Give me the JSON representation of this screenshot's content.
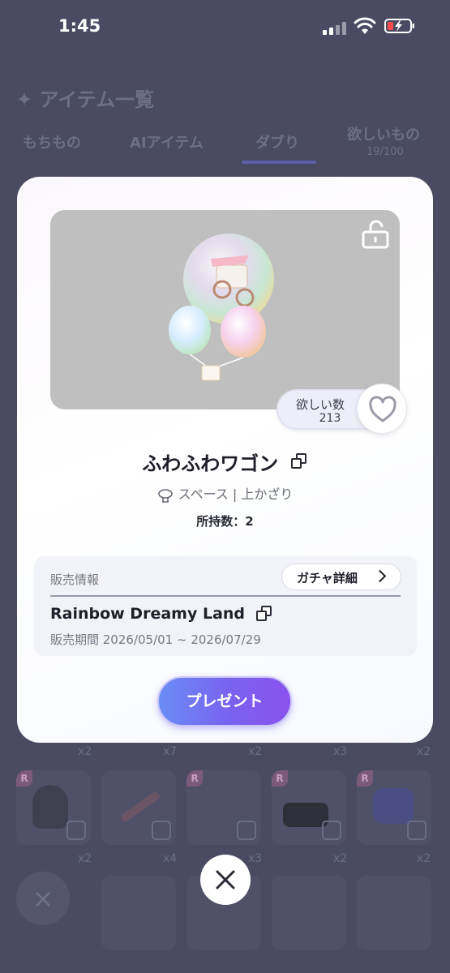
{
  "status_bar": {
    "time": "1:45"
  },
  "background": {
    "title": "アイテム一覧",
    "tabs": [
      {
        "label": "もちもの"
      },
      {
        "label": "AIアイテム"
      },
      {
        "label": "ダブり"
      },
      {
        "label": "欲しいもの",
        "sub": "19/100"
      }
    ],
    "row1_counts": [
      "x2",
      "x7",
      "x2",
      "x3",
      "x2"
    ],
    "row2_counts": [
      "x2",
      "x4",
      "x3",
      "x2",
      "x2"
    ],
    "rarity_label": "R"
  },
  "modal": {
    "wish": {
      "label": "欲しい数",
      "count": "213"
    },
    "item_name": "ふわふわワゴン",
    "category": "スペース | 上かざり",
    "owned": "所持数：2",
    "sale": {
      "label": "販売情報",
      "gacha_button": "ガチャ詳細",
      "gacha_name": "Rainbow Dreamy Land",
      "period": "販売期間 2026/05/01 ~ 2026/07/29"
    },
    "present_button": "プレゼント"
  },
  "colors": {
    "accent_start": "#6a8cf5",
    "accent_end": "#8a52ee",
    "overlay": "#4a4b63"
  }
}
